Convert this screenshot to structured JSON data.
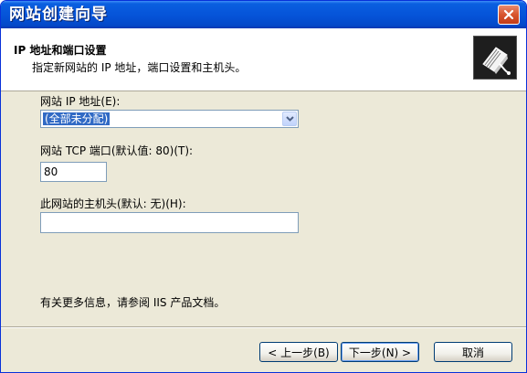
{
  "window": {
    "title": "网站创建向导"
  },
  "header": {
    "title": "IP 地址和端口设置",
    "subtitle": "指定新网站的 IP 地址，端口设置和主机头。"
  },
  "form": {
    "ip": {
      "label": "网站 IP 地址(E):",
      "selected": "(全部未分配)"
    },
    "port": {
      "label": "网站 TCP 端口(默认值: 80)(T):",
      "value": "80"
    },
    "host": {
      "label": "此网站的主机头(默认: 无)(H):",
      "value": ""
    }
  },
  "footer": {
    "note": "有关更多信息，请参阅 IIS 产品文档。"
  },
  "buttons": {
    "back": "< 上一步(B)",
    "next": "下一步(N) >",
    "cancel": "取消"
  },
  "colors": {
    "titlebar": "#0553d8",
    "dialog": "#ece9d8",
    "selection": "#316ac5",
    "input_border": "#7f9db9"
  },
  "icons": {
    "close": "close-icon",
    "wizard": "wizard-book-icon",
    "dropdown": "chevron-down-icon"
  }
}
